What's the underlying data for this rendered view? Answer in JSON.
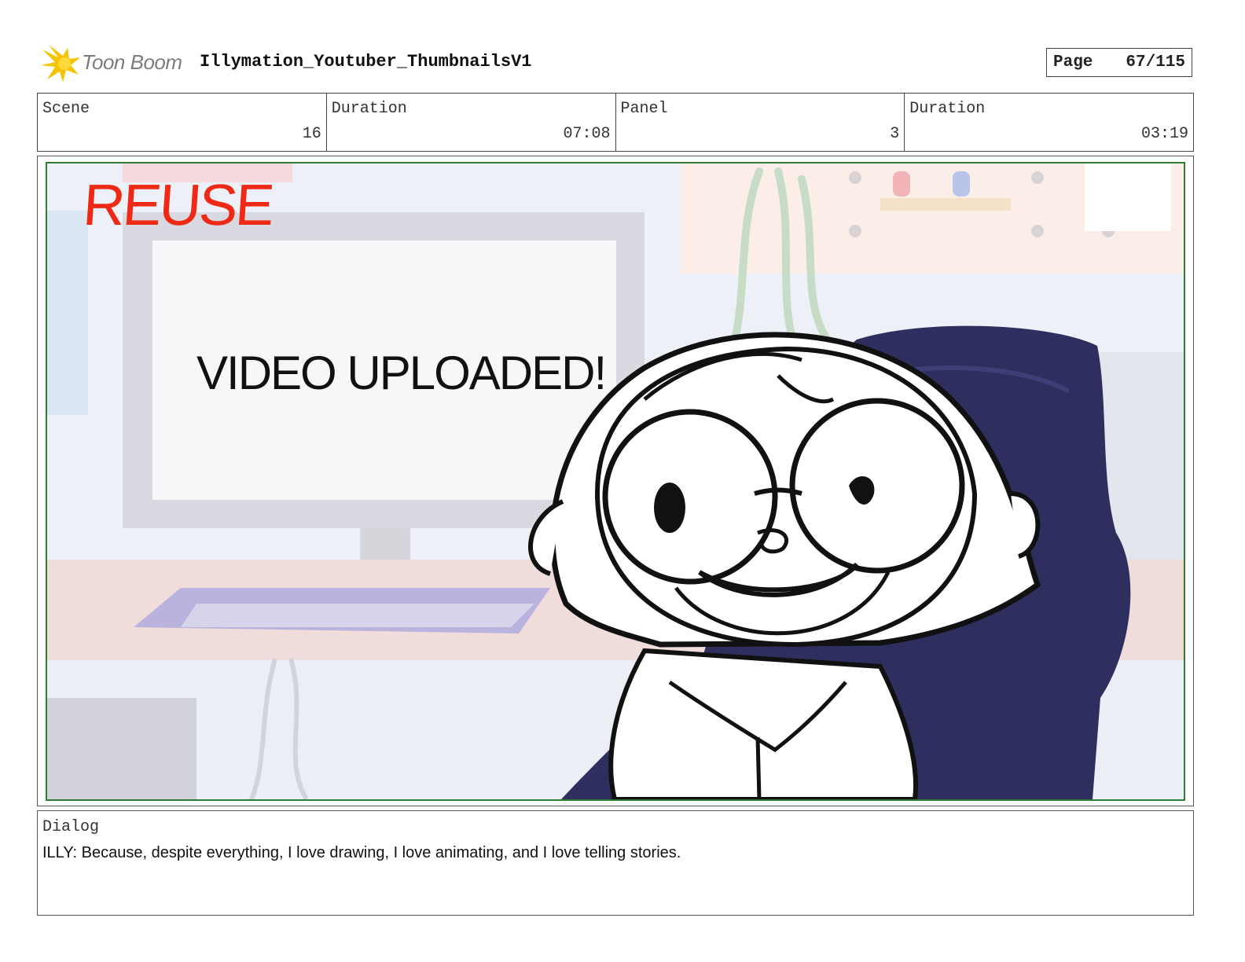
{
  "header": {
    "logo_text": "Toon Boom",
    "project_title": "Illymation_Youtuber_ThumbnailsV1",
    "page_label": "Page",
    "page_value": "67/115"
  },
  "info": {
    "scene_label": "Scene",
    "scene_value": "16",
    "scene_duration_label": "Duration",
    "scene_duration_value": "07:08",
    "panel_label": "Panel",
    "panel_value": "3",
    "panel_duration_label": "Duration",
    "panel_duration_value": "03:19"
  },
  "panel": {
    "reuse_text": "REUSE",
    "screen_text": "VIDEO UPLOADED!",
    "frame_color": "#2e7d32",
    "reuse_color": "#ee2a16"
  },
  "dialog": {
    "label": "Dialog",
    "text": "ILLY: Because, despite everything, I love drawing, I love animating, and I love telling stories."
  },
  "colors": {
    "logo_yellow": "#f5c400",
    "chair_navy": "#2e2f5e"
  }
}
